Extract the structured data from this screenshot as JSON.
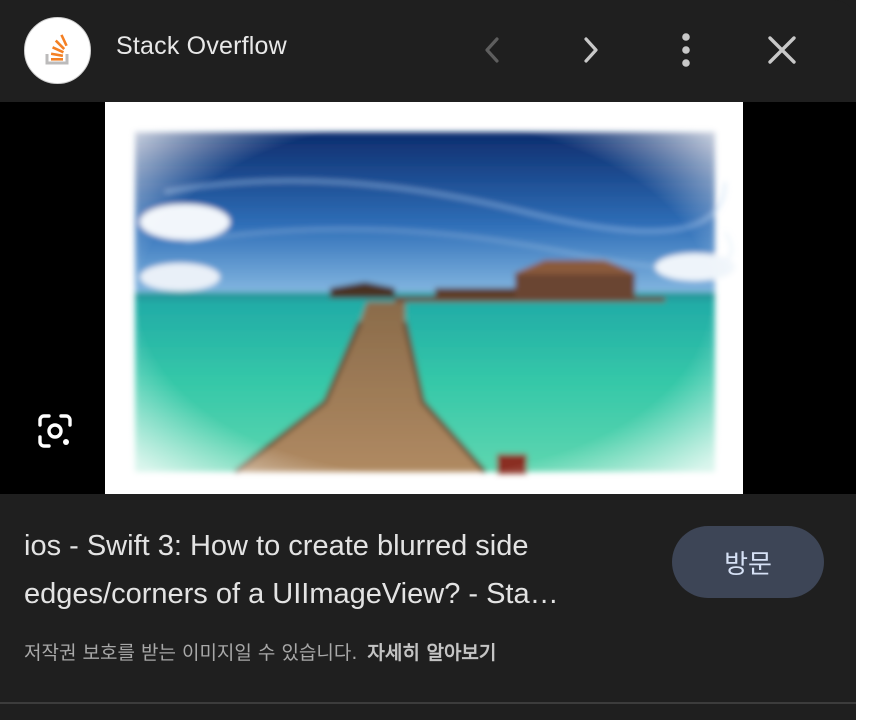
{
  "header": {
    "site_name": "Stack Overflow",
    "logo_icon": "stackoverflow-logo-icon",
    "prev_icon": "chevron-left-icon",
    "next_icon": "chevron-right-icon",
    "more_icon": "more-vert-icon",
    "close_icon": "close-icon"
  },
  "image": {
    "lens_icon": "google-lens-icon"
  },
  "result": {
    "title_line1": "ios - Swift 3: How to create blurred side",
    "title_line2": "edges/corners of a UIImageView? - Sta…",
    "visit_label": "방문",
    "copyright_notice": "저작권 보호를 받는 이미지일 수 있습니다.",
    "learn_more": "자세히 알아보기"
  },
  "colors": {
    "background": "#1f1f1f",
    "visit_button": "#3d4556",
    "logo_orange": "#f48024"
  }
}
